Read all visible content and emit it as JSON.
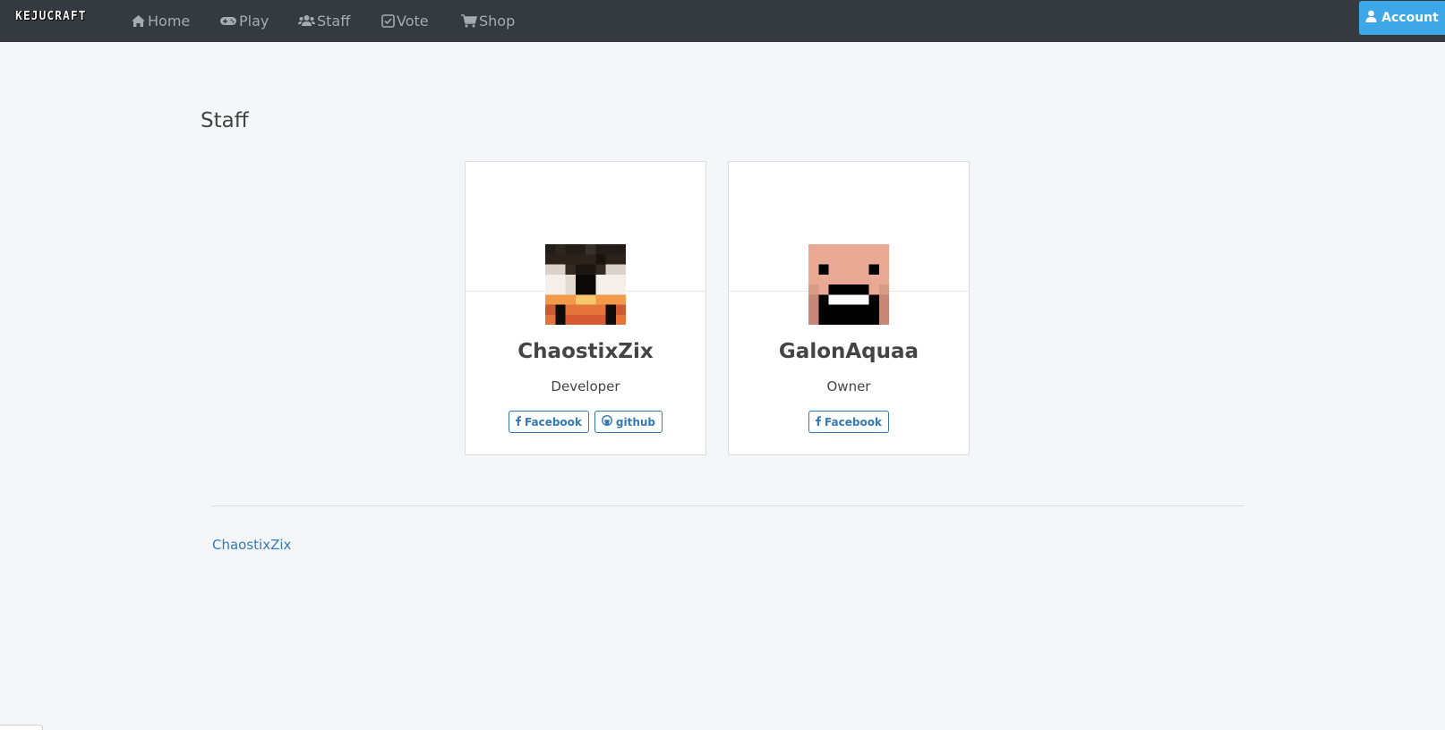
{
  "nav": {
    "logo_text": "KEJUCRAFT",
    "items": [
      {
        "label": "Home",
        "icon": "home-icon"
      },
      {
        "label": "Play",
        "icon": "gamepad-icon"
      },
      {
        "label": "Staff",
        "icon": "users-icon"
      },
      {
        "label": "Vote",
        "icon": "checkbox-icon"
      },
      {
        "label": "Shop",
        "icon": "cart-icon"
      }
    ],
    "account_label": "Account",
    "account_color": "#3ea7e8",
    "bar_color": "#343a40"
  },
  "page": {
    "title": "Staff"
  },
  "staff": [
    {
      "name": "ChaostixZix",
      "role": "Developer",
      "avatar": "pixel-skin-head",
      "links": [
        {
          "label": "Facebook",
          "icon": "facebook-icon"
        },
        {
          "label": "github",
          "icon": "github-icon"
        }
      ]
    },
    {
      "name": "GalonAquaa",
      "role": "Owner",
      "avatar": "pixel-skin-head",
      "links": [
        {
          "label": "Facebook",
          "icon": "facebook-icon"
        }
      ]
    }
  ],
  "footer": {
    "credit_link": "ChaostixZix"
  },
  "colors": {
    "link": "#337ab7",
    "background": "#f5f6fa"
  }
}
